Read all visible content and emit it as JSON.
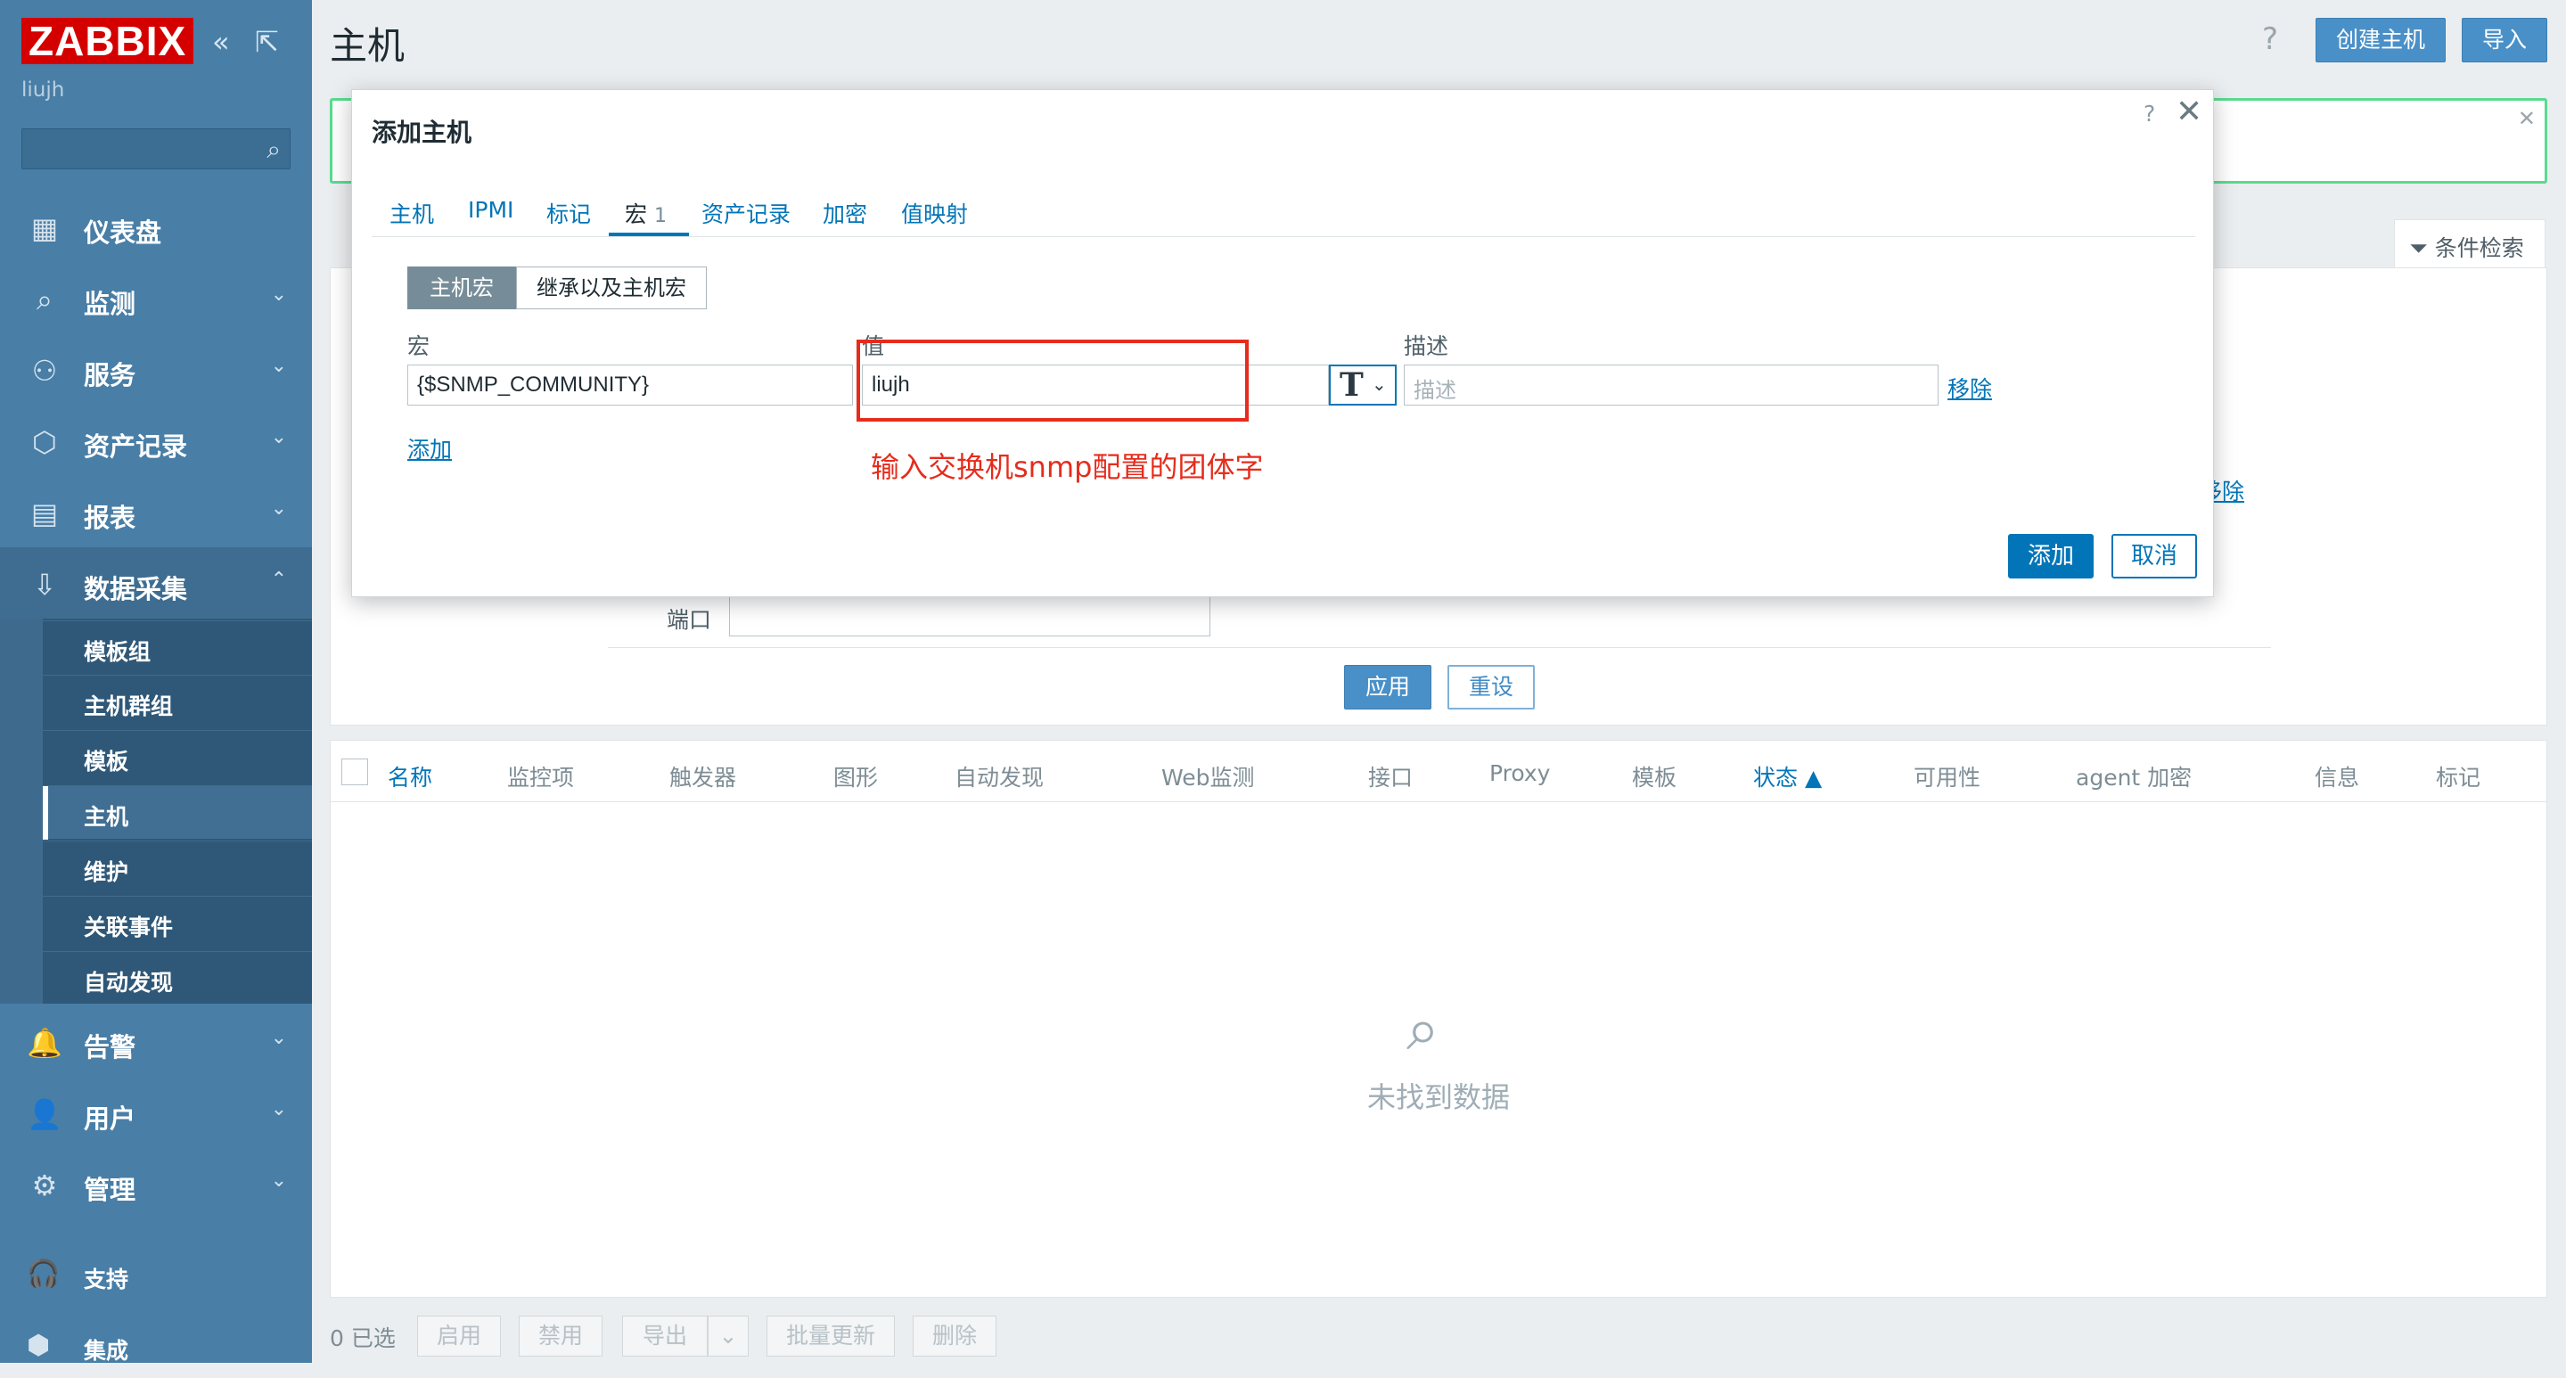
{
  "sidebar": {
    "logo": "ZABBIX",
    "collapse_glyph": "«",
    "popout_glyph": "⇱",
    "user": "liujh",
    "items": [
      {
        "label": "仪表盘",
        "icon": "dashboard-icon",
        "glyph": "▦"
      },
      {
        "label": "监测",
        "icon": "monitoring-icon",
        "glyph": "⌕"
      },
      {
        "label": "服务",
        "icon": "services-icon",
        "glyph": "⚇"
      },
      {
        "label": "资产记录",
        "icon": "inventory-icon",
        "glyph": "⬡"
      },
      {
        "label": "报表",
        "icon": "reports-icon",
        "glyph": "▤"
      },
      {
        "label": "数据采集",
        "icon": "data-collection-icon",
        "glyph": "⇩"
      },
      {
        "label": "告警",
        "icon": "alerts-icon",
        "glyph": "🔔"
      },
      {
        "label": "用户",
        "icon": "users-icon",
        "glyph": "👤"
      },
      {
        "label": "管理",
        "icon": "administration-icon",
        "glyph": "⚙"
      }
    ],
    "submenu": [
      "模板组",
      "主机群组",
      "模板",
      "主机",
      "维护",
      "关联事件",
      "自动发现"
    ],
    "footer": [
      {
        "label": "支持",
        "icon": "support-icon",
        "glyph": "🎧"
      },
      {
        "label": "集成",
        "icon": "integrations-icon",
        "glyph": "⬢"
      }
    ]
  },
  "header": {
    "title": "主机",
    "help": "?",
    "create_host": "创建主机",
    "import": "导入"
  },
  "filter": {
    "tab_label": "条件检索",
    "port_label": "端口",
    "apply": "应用",
    "reset": "重设",
    "remove_partial": "移除"
  },
  "table": {
    "columns": [
      "名称",
      "监控项",
      "触发器",
      "图形",
      "自动发现",
      "Web监测",
      "接口",
      "Proxy",
      "模板",
      "状态 ▲",
      "可用性",
      "agent 加密",
      "信息",
      "标记"
    ],
    "empty": "未找到数据",
    "selected": "0 已选",
    "actions": [
      "启用",
      "禁用",
      "导出",
      "批量更新",
      "删除"
    ]
  },
  "modal": {
    "title": "添加主机",
    "help": "?",
    "close": "✕",
    "tabs": [
      "主机",
      "IPMI",
      "标记",
      "宏",
      "资产记录",
      "加密",
      "值映射"
    ],
    "macro_count": "1",
    "seg_host": "主机宏",
    "seg_inherited": "继承以及主机宏",
    "label_macro": "宏",
    "label_value": "值",
    "label_desc": "描述",
    "macro_value": "{$SNMP_COMMUNITY}",
    "value_value": "liujh",
    "desc_placeholder": "描述",
    "type_glyph": "T",
    "remove": "移除",
    "add_row": "添加",
    "add_button": "添加",
    "cancel_button": "取消"
  },
  "annotation": {
    "text": "输入交换机snmp配置的团体字",
    "color": "#e62c1c"
  }
}
